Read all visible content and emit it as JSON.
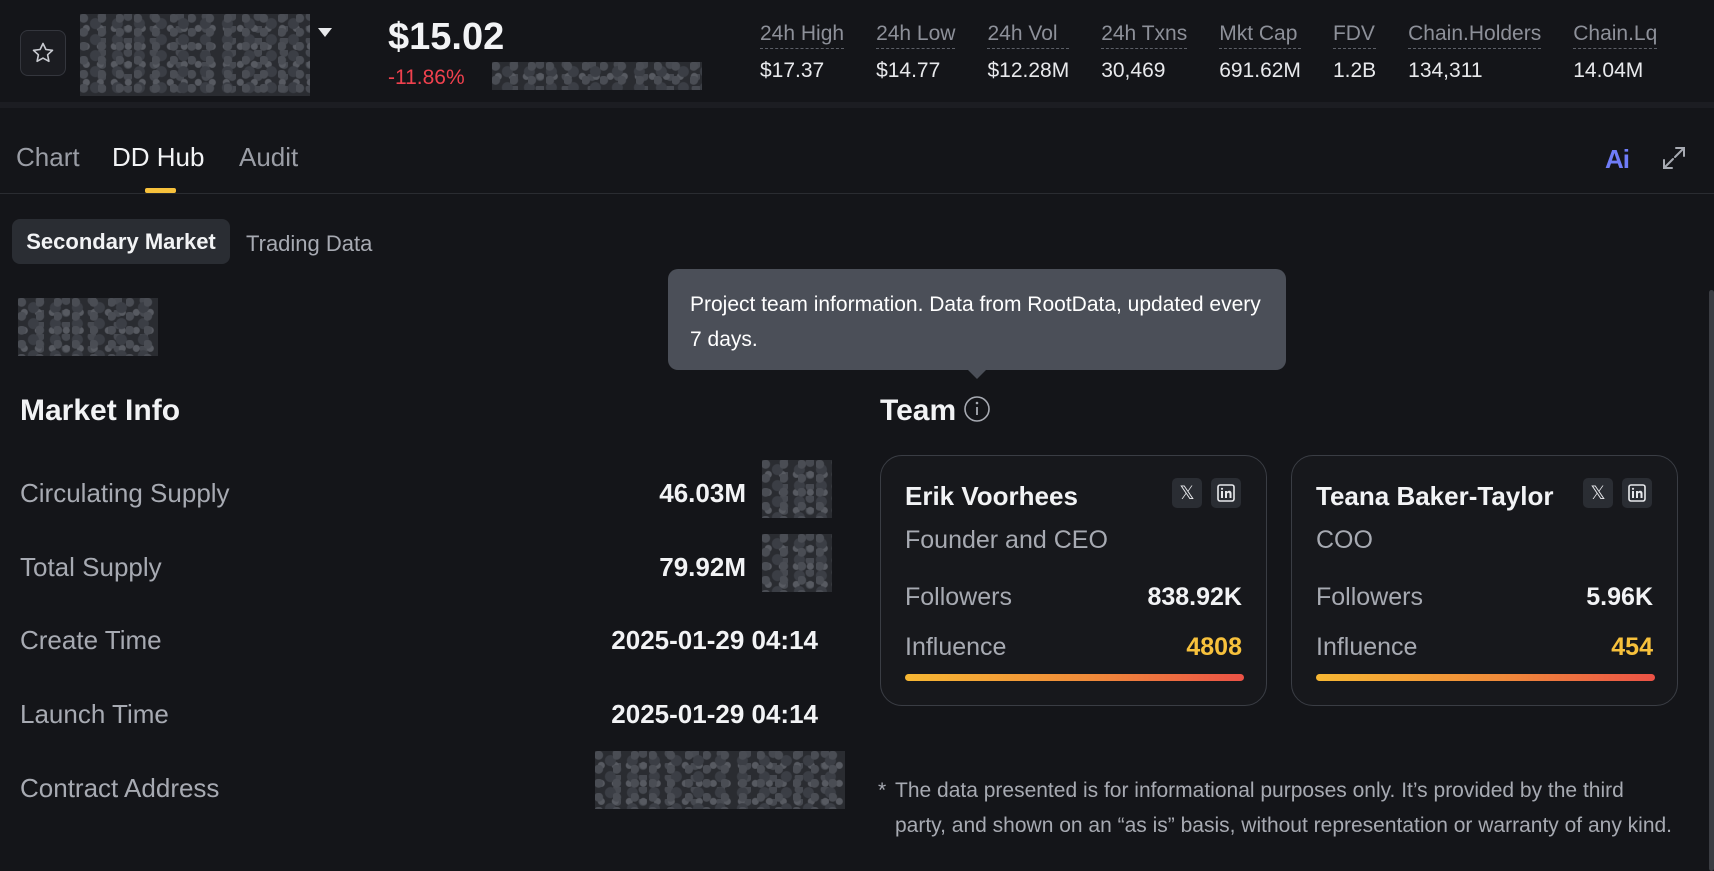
{
  "header": {
    "price": "$15.02",
    "change": "-11.86%",
    "stats": [
      {
        "label": "24h High",
        "value": "$17.37"
      },
      {
        "label": "24h Low",
        "value": "$14.77"
      },
      {
        "label": "24h Vol",
        "value": "$12.28M"
      },
      {
        "label": "24h Txns",
        "value": "30,469"
      },
      {
        "label": "Mkt Cap",
        "value": "691.62M"
      },
      {
        "label": "FDV",
        "value": "1.2B"
      },
      {
        "label": "Chain.Holders",
        "value": "134,311"
      },
      {
        "label": "Chain.Lq",
        "value": "14.04M"
      }
    ]
  },
  "tabs": [
    "Chart",
    "DD Hub",
    "Audit"
  ],
  "ai_label": "Ai",
  "subtabs": {
    "active": "Secondary Market",
    "other": "Trading Data"
  },
  "market_info": {
    "title": "Market Info",
    "rows": [
      {
        "label": "Circulating Supply",
        "value": "46.03M"
      },
      {
        "label": "Total Supply",
        "value": "79.92M"
      },
      {
        "label": "Create Time",
        "value": "2025-01-29 04:14"
      },
      {
        "label": "Launch Time",
        "value": "2025-01-29 04:14"
      },
      {
        "label": "Contract Address",
        "value": ""
      }
    ]
  },
  "team": {
    "title": "Team",
    "tooltip": "Project team information. Data from RootData, updated every 7 days.",
    "followers_label": "Followers",
    "influence_label": "Influence",
    "members": [
      {
        "name": "Erik Voorhees",
        "role": "Founder and CEO",
        "followers": "838.92K",
        "influence": "4808"
      },
      {
        "name": "Teana Baker-Taylor",
        "role": "COO",
        "followers": "5.96K",
        "influence": "454"
      }
    ]
  },
  "disclaimer": "The data presented is for informational purposes only. It’s provided by the third party, and shown on an “as is” basis, without representation or warranty of any kind.",
  "colors": {
    "accent": "#f7c13c",
    "negative": "#f0414e",
    "ai": "#6f7cf7"
  }
}
